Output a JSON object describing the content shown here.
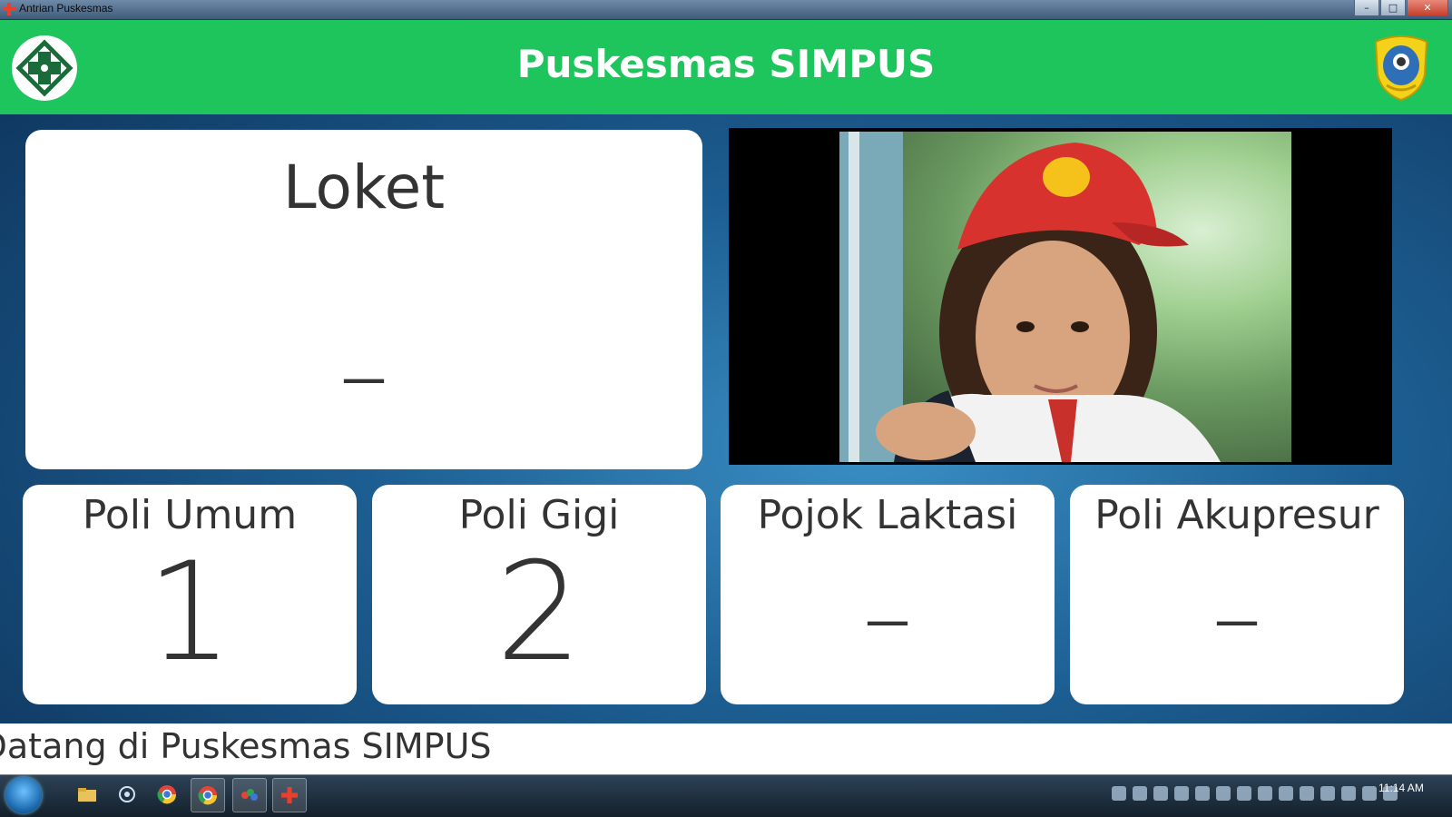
{
  "window": {
    "title": "Antrian Puskesmas",
    "minimize_label": "–",
    "maximize_label": "□",
    "close_label": "✕"
  },
  "header": {
    "title": "Puskesmas SIMPUS",
    "logo_left_icon": "puskesmas-cross-logo",
    "logo_right_icon": "regional-emblem-logo",
    "background_color": "#1ec45c"
  },
  "loket": {
    "title": "Loket",
    "number": "–"
  },
  "video": {
    "icon": "video-player"
  },
  "poli": [
    {
      "title": "Poli Umum",
      "number": "1"
    },
    {
      "title": "Poli Gigi",
      "number": "2"
    },
    {
      "title": "Pojok Laktasi",
      "number": "–"
    },
    {
      "title": "Poli Akupresur",
      "number": "–"
    }
  ],
  "marquee": {
    "text": "Selamat Datang di Puskesmas SIMPUS"
  },
  "taskbar": {
    "clock": "11:14 AM",
    "items": [
      "start-orb",
      "file-explorer-icon",
      "network-icon",
      "chrome-icon",
      "chrome-icon",
      "paint-icon",
      "puskesmas-app-icon"
    ]
  }
}
